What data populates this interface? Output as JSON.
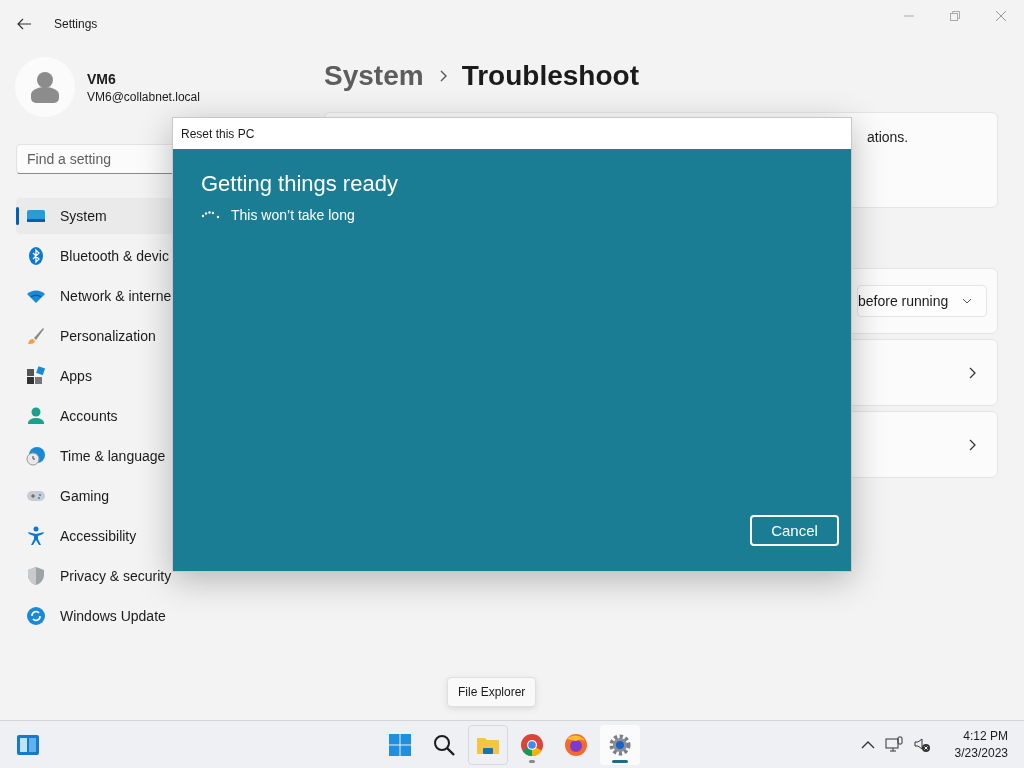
{
  "window": {
    "title": "Settings"
  },
  "profile": {
    "name": "VM6",
    "email": "VM6@collabnet.local"
  },
  "search": {
    "placeholder": "Find a setting"
  },
  "sidebar": {
    "items": [
      {
        "label": "System",
        "selected": true
      },
      {
        "label": "Bluetooth & devic",
        "selected": false
      },
      {
        "label": "Network & interne",
        "selected": false
      },
      {
        "label": "Personalization",
        "selected": false
      },
      {
        "label": "Apps",
        "selected": false
      },
      {
        "label": "Accounts",
        "selected": false
      },
      {
        "label": "Time & language",
        "selected": false
      },
      {
        "label": "Gaming",
        "selected": false
      },
      {
        "label": "Accessibility",
        "selected": false
      },
      {
        "label": "Privacy & security",
        "selected": false
      },
      {
        "label": "Windows Update",
        "selected": false
      }
    ]
  },
  "breadcrumb": {
    "parent": "System",
    "current": "Troubleshoot"
  },
  "cards": [
    {
      "kind": "text",
      "text": "ations."
    },
    {
      "kind": "dropdown",
      "value": "before running"
    },
    {
      "kind": "link"
    },
    {
      "kind": "link"
    }
  ],
  "dialog": {
    "title": "Reset this PC",
    "heading": "Getting things ready",
    "message": "This won’t take long",
    "button": "Cancel"
  },
  "tooltip": "File Explorer",
  "taskbar": {
    "apps": [
      {
        "running": false,
        "selected": false,
        "hovered": false
      },
      {
        "running": false,
        "selected": false,
        "hovered": false
      },
      {
        "running": false,
        "selected": false,
        "hovered": true
      },
      {
        "running": true,
        "selected": false,
        "hovered": false
      },
      {
        "running": false,
        "selected": false,
        "hovered": false
      },
      {
        "running": true,
        "selected": true,
        "hovered": false
      }
    ]
  },
  "clock": {
    "time": "4:12 PM",
    "date": "3/23/2023"
  }
}
